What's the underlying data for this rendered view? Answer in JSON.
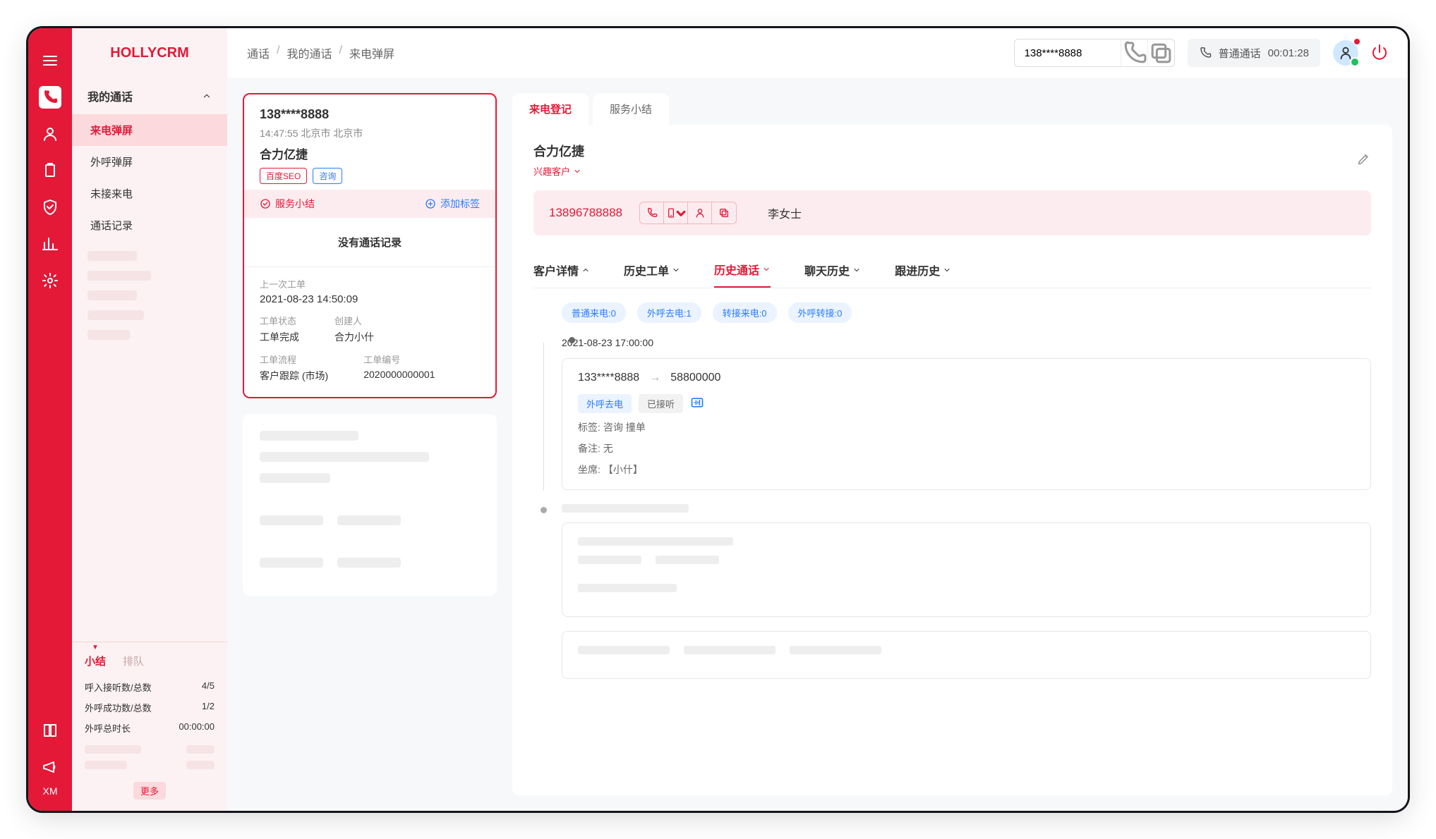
{
  "logo": "HOLLYCRM",
  "breadcrumb": {
    "a": "通话",
    "b": "我的通话",
    "c": "来电弹屏"
  },
  "topbar": {
    "phone_value": "138****8888",
    "status_label": "普通通话",
    "timer": "00:01:28"
  },
  "sidebar": {
    "group_title": "我的通话",
    "items": [
      "来电弹屏",
      "外呼弹屏",
      "未接来电",
      "通话记录"
    ],
    "stats_tabs": [
      "小结",
      "排队"
    ],
    "stat_rows": [
      {
        "label": "呼入接听数/总数",
        "value": "4/5"
      },
      {
        "label": "外呼成功数/总数",
        "value": "1/2"
      },
      {
        "label": "外呼总时长",
        "value": "00:00:00"
      }
    ],
    "more": "更多"
  },
  "caller": {
    "phone": "138****8888",
    "time_loc": "14:47:55 北京市  北京市",
    "company": "合力亿捷",
    "tags": [
      "百度SEO",
      "咨询"
    ],
    "action_summary": "服务小结",
    "action_addtag": "添加标签",
    "no_record": "没有通话记录",
    "order": {
      "last_label": "上一次工单",
      "time": "2021-08-23 14:50:09",
      "status_label": "工单状态",
      "status_value": "工单完成",
      "creator_label": "创建人",
      "creator_value": "合力小什",
      "flow_label": "工单流程",
      "no_label": "工单编号",
      "flow_value": "客户跟踪 (市场)",
      "no_value": "2020000000001"
    }
  },
  "detail": {
    "tabs_top": [
      "来电登记",
      "服务小结"
    ],
    "customer_name": "合力亿捷",
    "customer_type": "兴趣客户",
    "phone": "13896788888",
    "contact": "李女士",
    "tabs": [
      "客户详情",
      "历史工单",
      "历史通话",
      "聊天历史",
      "跟进历史"
    ],
    "pills": [
      "普通来电:0",
      "外呼去电:1",
      "转接来电:0",
      "外呼转接:0"
    ],
    "timeline": {
      "time": "2021-08-23  17:00:00",
      "from": "133****8888",
      "to": "58800000",
      "chip_type": "外呼去电",
      "chip_status": "已接听",
      "tag_label": "标签:",
      "tag_value": "咨询   撞单",
      "note_label": "备注:",
      "note_value": "无",
      "agent_label": "坐席:",
      "agent_value": "【小什】"
    }
  }
}
